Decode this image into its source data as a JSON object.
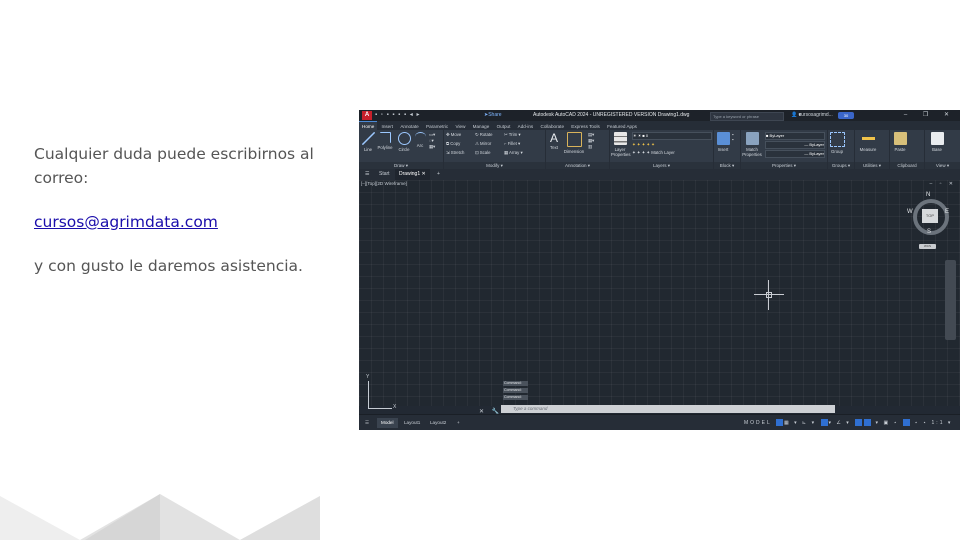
{
  "slide": {
    "line1": "Cualquier duda puede escribirnos al correo:",
    "email": "cursos@agrimdata.com",
    "line2": "y con gusto le daremos asistencia."
  },
  "autocad": {
    "title": "Autodesk AutoCAD 2024 - UNREGISTERED VERSION   Drawing1.dwg",
    "share": "Share",
    "search_placeholder": "Type a keyword or phrase",
    "user": "cursosagrimd...",
    "cloud": "30",
    "ribbon_tabs": [
      "Home",
      "Insert",
      "Annotate",
      "Parametric",
      "View",
      "Manage",
      "Output",
      "Add-ins",
      "Collaborate",
      "Express Tools",
      "Featured Apps"
    ],
    "panels": {
      "draw": "Draw",
      "modify": "Modify",
      "annotation": "Annotation",
      "layers": "Layers",
      "block": "Block",
      "properties": "Properties",
      "groups": "Groups",
      "utilities": "Utilities",
      "clipboard": "Clipboard",
      "view": "View"
    },
    "tools": {
      "line": "Line",
      "polyline": "Polyline",
      "circle": "Circle",
      "arc": "Arc",
      "move": "Move",
      "rotate": "Rotate",
      "trim": "Trim",
      "copy": "Copy",
      "mirror": "Mirror",
      "fillet": "Fillet",
      "stretch": "Stretch",
      "scale": "Scale",
      "array": "Array",
      "text": "Text",
      "dimension": "Dimension",
      "layer_properties": "Layer Properties",
      "match_layer": "Match Layer",
      "insert": "Insert",
      "match_properties": "Match Properties",
      "bylayer": "ByLayer",
      "group": "Group",
      "measure": "Measure",
      "paste": "Paste",
      "base": "Base"
    },
    "file_tabs": {
      "start": "Start",
      "drawing": "Drawing1"
    },
    "viewport_label": "[–][Top][2D Wireframe]",
    "viewcube": {
      "n": "N",
      "s": "S",
      "e": "E",
      "w": "W",
      "top": "TOP",
      "wcs": "WCS"
    },
    "ucs": {
      "x": "X",
      "y": "Y"
    },
    "command_history": [
      "Command:",
      "Command:",
      "Command:"
    ],
    "command_placeholder": "Type a command",
    "layout_tabs": [
      "Model",
      "Layout1",
      "Layout2"
    ],
    "status": {
      "model": "MODEL",
      "scale": "1:1"
    }
  },
  "colors": {
    "link": "#1a0dab",
    "text": "#555555",
    "autocad_bg": "#212830",
    "autocad_red": "#c8202b",
    "accent_blue": "#2f6fd1"
  }
}
